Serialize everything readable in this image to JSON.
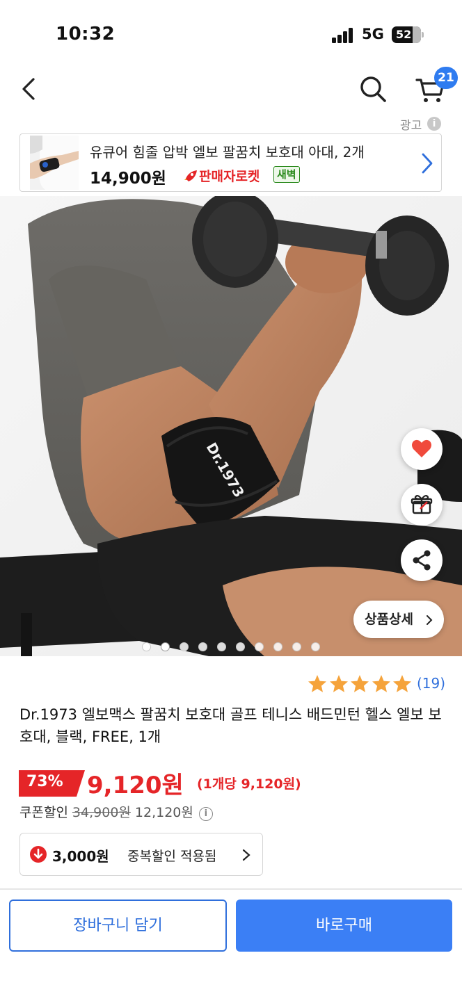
{
  "status_bar": {
    "time": "10:32",
    "network": "5G",
    "battery": "52"
  },
  "nav": {
    "back_icon": "chevron-left-icon",
    "search_icon": "search-icon",
    "cart_icon": "cart-icon",
    "cart_count": "21"
  },
  "ad": {
    "label": "광고",
    "info_glyph": "i",
    "title": "유큐어 힘줄 압박 엘보 팔꿈치 보호대 아대, 2개",
    "price": "14,900원",
    "rocket_label": "판매자로켓",
    "dawn_badge": "새벽"
  },
  "hero": {
    "band_text": "Dr.1973",
    "actions": {
      "like_icon": "heart-icon",
      "gift_icon": "gift-icon",
      "share_icon": "share-icon",
      "detail_label": "상품상세"
    },
    "slides_total": 10,
    "active_slide": 2
  },
  "rating": {
    "stars": 5,
    "review_count": "(19)"
  },
  "product": {
    "title": "Dr.1973 엘보맥스 팔꿈치 보호대 골프 테니스 배드민턴 헬스 엘보 보호대, 블랙, FREE, 1개"
  },
  "price": {
    "discount": "73%",
    "sale_price": "9,120원",
    "unit_price": "(1개당 9,120원)",
    "coupon_label": "쿠폰할인",
    "original_price": "34,900원",
    "coupon_amount": "12,120원",
    "coupon_info_glyph": "i"
  },
  "stack_discount": {
    "amount": "3,000원",
    "text": "중복할인 적용됨"
  },
  "actions": {
    "add_to_cart": "장바구니 담기",
    "buy_now": "바로구매"
  },
  "colors": {
    "accent_blue": "#3b7ff5",
    "sale_red": "#e52528",
    "star_orange": "#f5a33b",
    "dawn_green": "#2a8a1c"
  }
}
